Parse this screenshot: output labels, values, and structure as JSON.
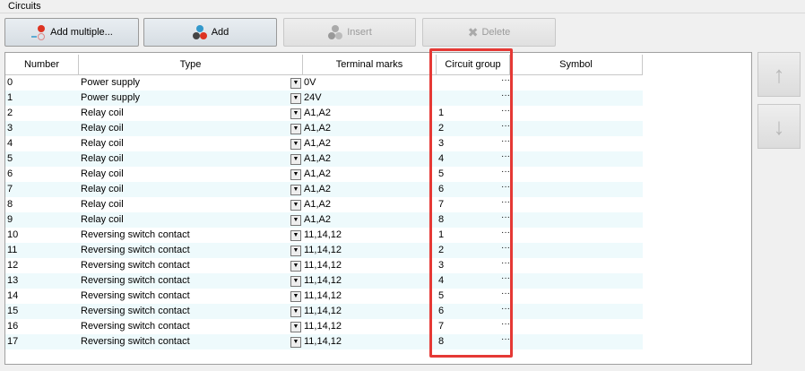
{
  "group_title": "Circuits",
  "toolbar": {
    "add_multiple": "Add multiple...",
    "add": "Add",
    "insert": "Insert",
    "delete": "Delete"
  },
  "columns": [
    "Number",
    "Type",
    "Terminal marks",
    "Circuit group",
    "Symbol"
  ],
  "rows": [
    {
      "number": "0",
      "type": "Power supply",
      "terminal": "0V",
      "group": ""
    },
    {
      "number": "1",
      "type": "Power supply",
      "terminal": "24V",
      "group": ""
    },
    {
      "number": "2",
      "type": "Relay coil",
      "terminal": "A1,A2",
      "group": "1"
    },
    {
      "number": "3",
      "type": "Relay coil",
      "terminal": "A1,A2",
      "group": "2"
    },
    {
      "number": "4",
      "type": "Relay coil",
      "terminal": "A1,A2",
      "group": "3"
    },
    {
      "number": "5",
      "type": "Relay coil",
      "terminal": "A1,A2",
      "group": "4"
    },
    {
      "number": "6",
      "type": "Relay coil",
      "terminal": "A1,A2",
      "group": "5"
    },
    {
      "number": "7",
      "type": "Relay coil",
      "terminal": "A1,A2",
      "group": "6"
    },
    {
      "number": "8",
      "type": "Relay coil",
      "terminal": "A1,A2",
      "group": "7"
    },
    {
      "number": "9",
      "type": "Relay coil",
      "terminal": "A1,A2",
      "group": "8"
    },
    {
      "number": "10",
      "type": "Reversing switch contact",
      "terminal": "11,14,12",
      "group": "1"
    },
    {
      "number": "11",
      "type": "Reversing switch contact",
      "terminal": "11,14,12",
      "group": "2"
    },
    {
      "number": "12",
      "type": "Reversing switch contact",
      "terminal": "11,14,12",
      "group": "3"
    },
    {
      "number": "13",
      "type": "Reversing switch contact",
      "terminal": "11,14,12",
      "group": "4"
    },
    {
      "number": "14",
      "type": "Reversing switch contact",
      "terminal": "11,14,12",
      "group": "5"
    },
    {
      "number": "15",
      "type": "Reversing switch contact",
      "terminal": "11,14,12",
      "group": "6"
    },
    {
      "number": "16",
      "type": "Reversing switch contact",
      "terminal": "11,14,12",
      "group": "7"
    },
    {
      "number": "17",
      "type": "Reversing switch contact",
      "terminal": "11,14,12",
      "group": "8"
    }
  ],
  "ellipsis": "···",
  "side": {
    "up": "↑",
    "down": "↓"
  }
}
